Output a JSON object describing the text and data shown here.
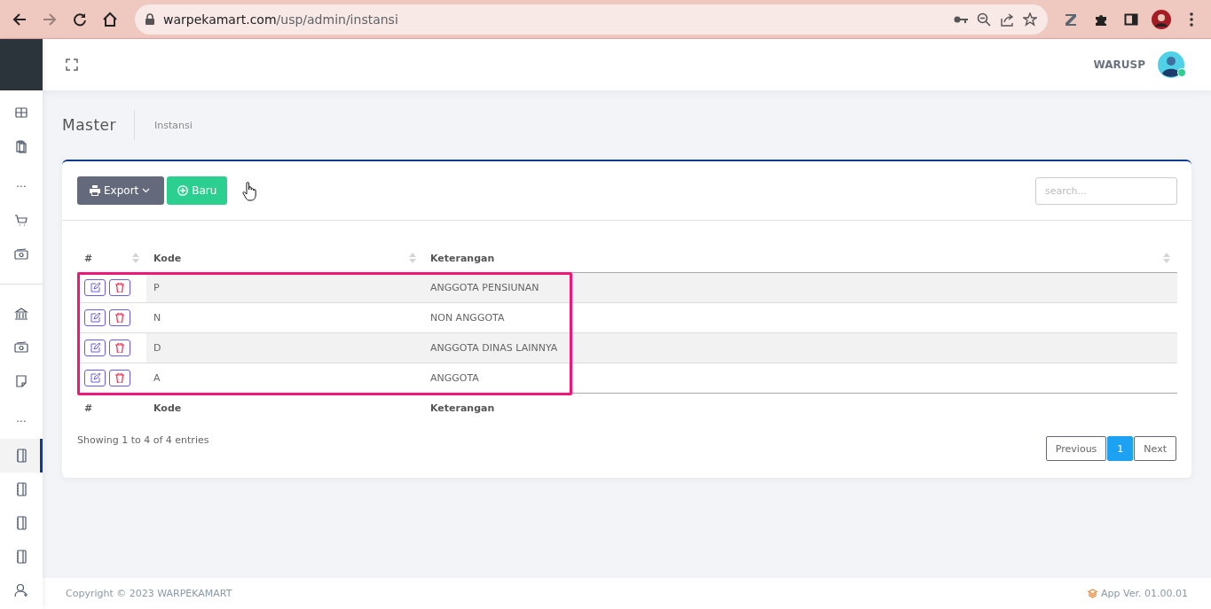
{
  "browser": {
    "url_host": "warpekamart.com",
    "url_path": "/usp/admin/instansi"
  },
  "sidebar": {
    "items": [
      {
        "kind": "icon",
        "selected": false
      },
      {
        "kind": "icon",
        "selected": false
      },
      {
        "kind": "dots",
        "label": "..."
      },
      {
        "kind": "icon",
        "selected": false
      },
      {
        "kind": "icon",
        "selected": false
      },
      {
        "kind": "divider"
      },
      {
        "kind": "icon",
        "selected": false
      },
      {
        "kind": "icon",
        "selected": false
      },
      {
        "kind": "icon",
        "selected": false
      },
      {
        "kind": "dots",
        "label": "..."
      },
      {
        "kind": "icon",
        "selected": true
      },
      {
        "kind": "icon",
        "selected": false
      },
      {
        "kind": "icon",
        "selected": false
      },
      {
        "kind": "icon",
        "selected": false
      },
      {
        "kind": "icon",
        "selected": false
      }
    ]
  },
  "header": {
    "user": "WARUSP",
    "online": true
  },
  "page": {
    "title": "Master",
    "breadcrumb": "Instansi"
  },
  "toolbar": {
    "export": "Export",
    "new": "Baru",
    "search_placeholder": "search..."
  },
  "table": {
    "columns": [
      "#",
      "Kode",
      "Keterangan"
    ],
    "rows": [
      {
        "kode": "P",
        "keterangan": "ANGGOTA PENSIUNAN"
      },
      {
        "kode": "N",
        "keterangan": "NON ANGGOTA"
      },
      {
        "kode": "D",
        "keterangan": "ANGGOTA DINAS LAINNYA"
      },
      {
        "kode": "A",
        "keterangan": "ANGGOTA"
      }
    ],
    "highlight_box": true,
    "footer_columns": [
      "#",
      "Kode",
      "Keterangan"
    ],
    "info": "Showing 1 to 4 of 4 entries",
    "pagination": [
      {
        "label": "Previous",
        "selected": false
      },
      {
        "label": "1",
        "selected": true
      },
      {
        "label": "Next",
        "selected": false
      }
    ]
  },
  "footer": {
    "copyright": "Copyright © 2023 WARPEKAMART",
    "version": "App Ver. 01.00.01"
  }
}
